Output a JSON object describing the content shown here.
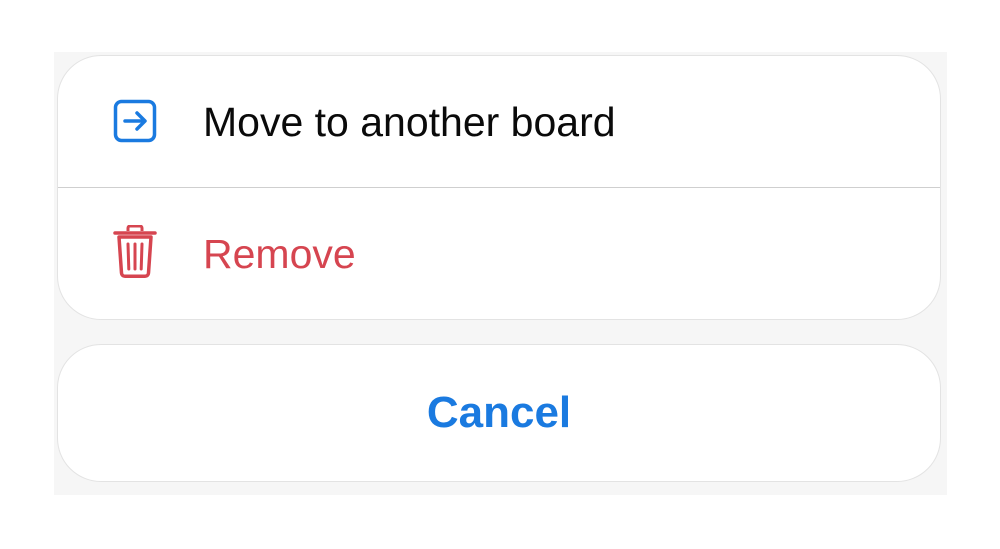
{
  "action_sheet": {
    "items": [
      {
        "label": "Move to another board",
        "icon": "move-arrow-icon",
        "color": "#0a0a0a",
        "icon_color": "#1a7ae0"
      },
      {
        "label": "Remove",
        "icon": "trash-icon",
        "color": "#d64550",
        "icon_color": "#d64550"
      }
    ],
    "cancel_label": "Cancel",
    "cancel_color": "#1a7ae0"
  }
}
